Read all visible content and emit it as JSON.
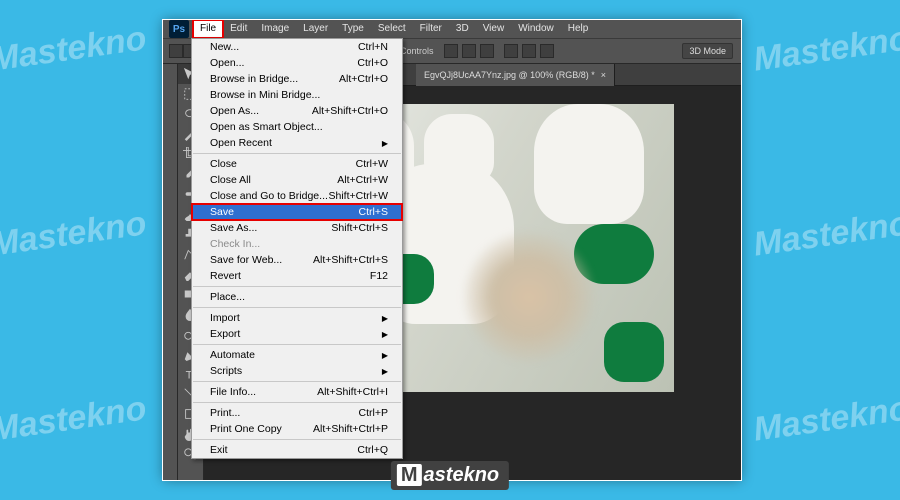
{
  "watermark": "Mastekno",
  "brand": {
    "m": "M",
    "rest": "astekno"
  },
  "menubar": [
    "File",
    "Edit",
    "Image",
    "Layer",
    "Type",
    "Select",
    "Filter",
    "3D",
    "View",
    "Window",
    "Help"
  ],
  "menubar_active_index": 0,
  "ps_logo": "Ps",
  "options": {
    "controls_label": "rm Controls",
    "btn_3d": "3D Mode"
  },
  "tab": {
    "title": "EgvQJj8UcAA7Ynz.jpg @ 100% (RGB/8) *",
    "close": "×"
  },
  "dropdown": {
    "groups": [
      [
        {
          "label": "New...",
          "shortcut": "Ctrl+N"
        },
        {
          "label": "Open...",
          "shortcut": "Ctrl+O"
        },
        {
          "label": "Browse in Bridge...",
          "shortcut": "Alt+Ctrl+O"
        },
        {
          "label": "Browse in Mini Bridge..."
        },
        {
          "label": "Open As...",
          "shortcut": "Alt+Shift+Ctrl+O"
        },
        {
          "label": "Open as Smart Object..."
        },
        {
          "label": "Open Recent",
          "submenu": true
        }
      ],
      [
        {
          "label": "Close",
          "shortcut": "Ctrl+W"
        },
        {
          "label": "Close All",
          "shortcut": "Alt+Ctrl+W"
        },
        {
          "label": "Close and Go to Bridge...",
          "shortcut": "Shift+Ctrl+W"
        },
        {
          "label": "Save",
          "shortcut": "Ctrl+S",
          "highlight": true
        },
        {
          "label": "Save As...",
          "shortcut": "Shift+Ctrl+S"
        },
        {
          "label": "Check In...",
          "disabled": true
        },
        {
          "label": "Save for Web...",
          "shortcut": "Alt+Shift+Ctrl+S"
        },
        {
          "label": "Revert",
          "shortcut": "F12"
        }
      ],
      [
        {
          "label": "Place..."
        }
      ],
      [
        {
          "label": "Import",
          "submenu": true
        },
        {
          "label": "Export",
          "submenu": true
        }
      ],
      [
        {
          "label": "Automate",
          "submenu": true
        },
        {
          "label": "Scripts",
          "submenu": true
        }
      ],
      [
        {
          "label": "File Info...",
          "shortcut": "Alt+Shift+Ctrl+I"
        }
      ],
      [
        {
          "label": "Print...",
          "shortcut": "Ctrl+P"
        },
        {
          "label": "Print One Copy",
          "shortcut": "Alt+Shift+Ctrl+P"
        }
      ],
      [
        {
          "label": "Exit",
          "shortcut": "Ctrl+Q"
        }
      ]
    ]
  },
  "tools": [
    "move",
    "marquee",
    "lasso",
    "wand",
    "crop",
    "eyedrop",
    "heal",
    "brush",
    "stamp",
    "history",
    "eraser",
    "gradient",
    "blur",
    "dodge",
    "pen",
    "type",
    "path",
    "rect",
    "hand",
    "zoom"
  ]
}
